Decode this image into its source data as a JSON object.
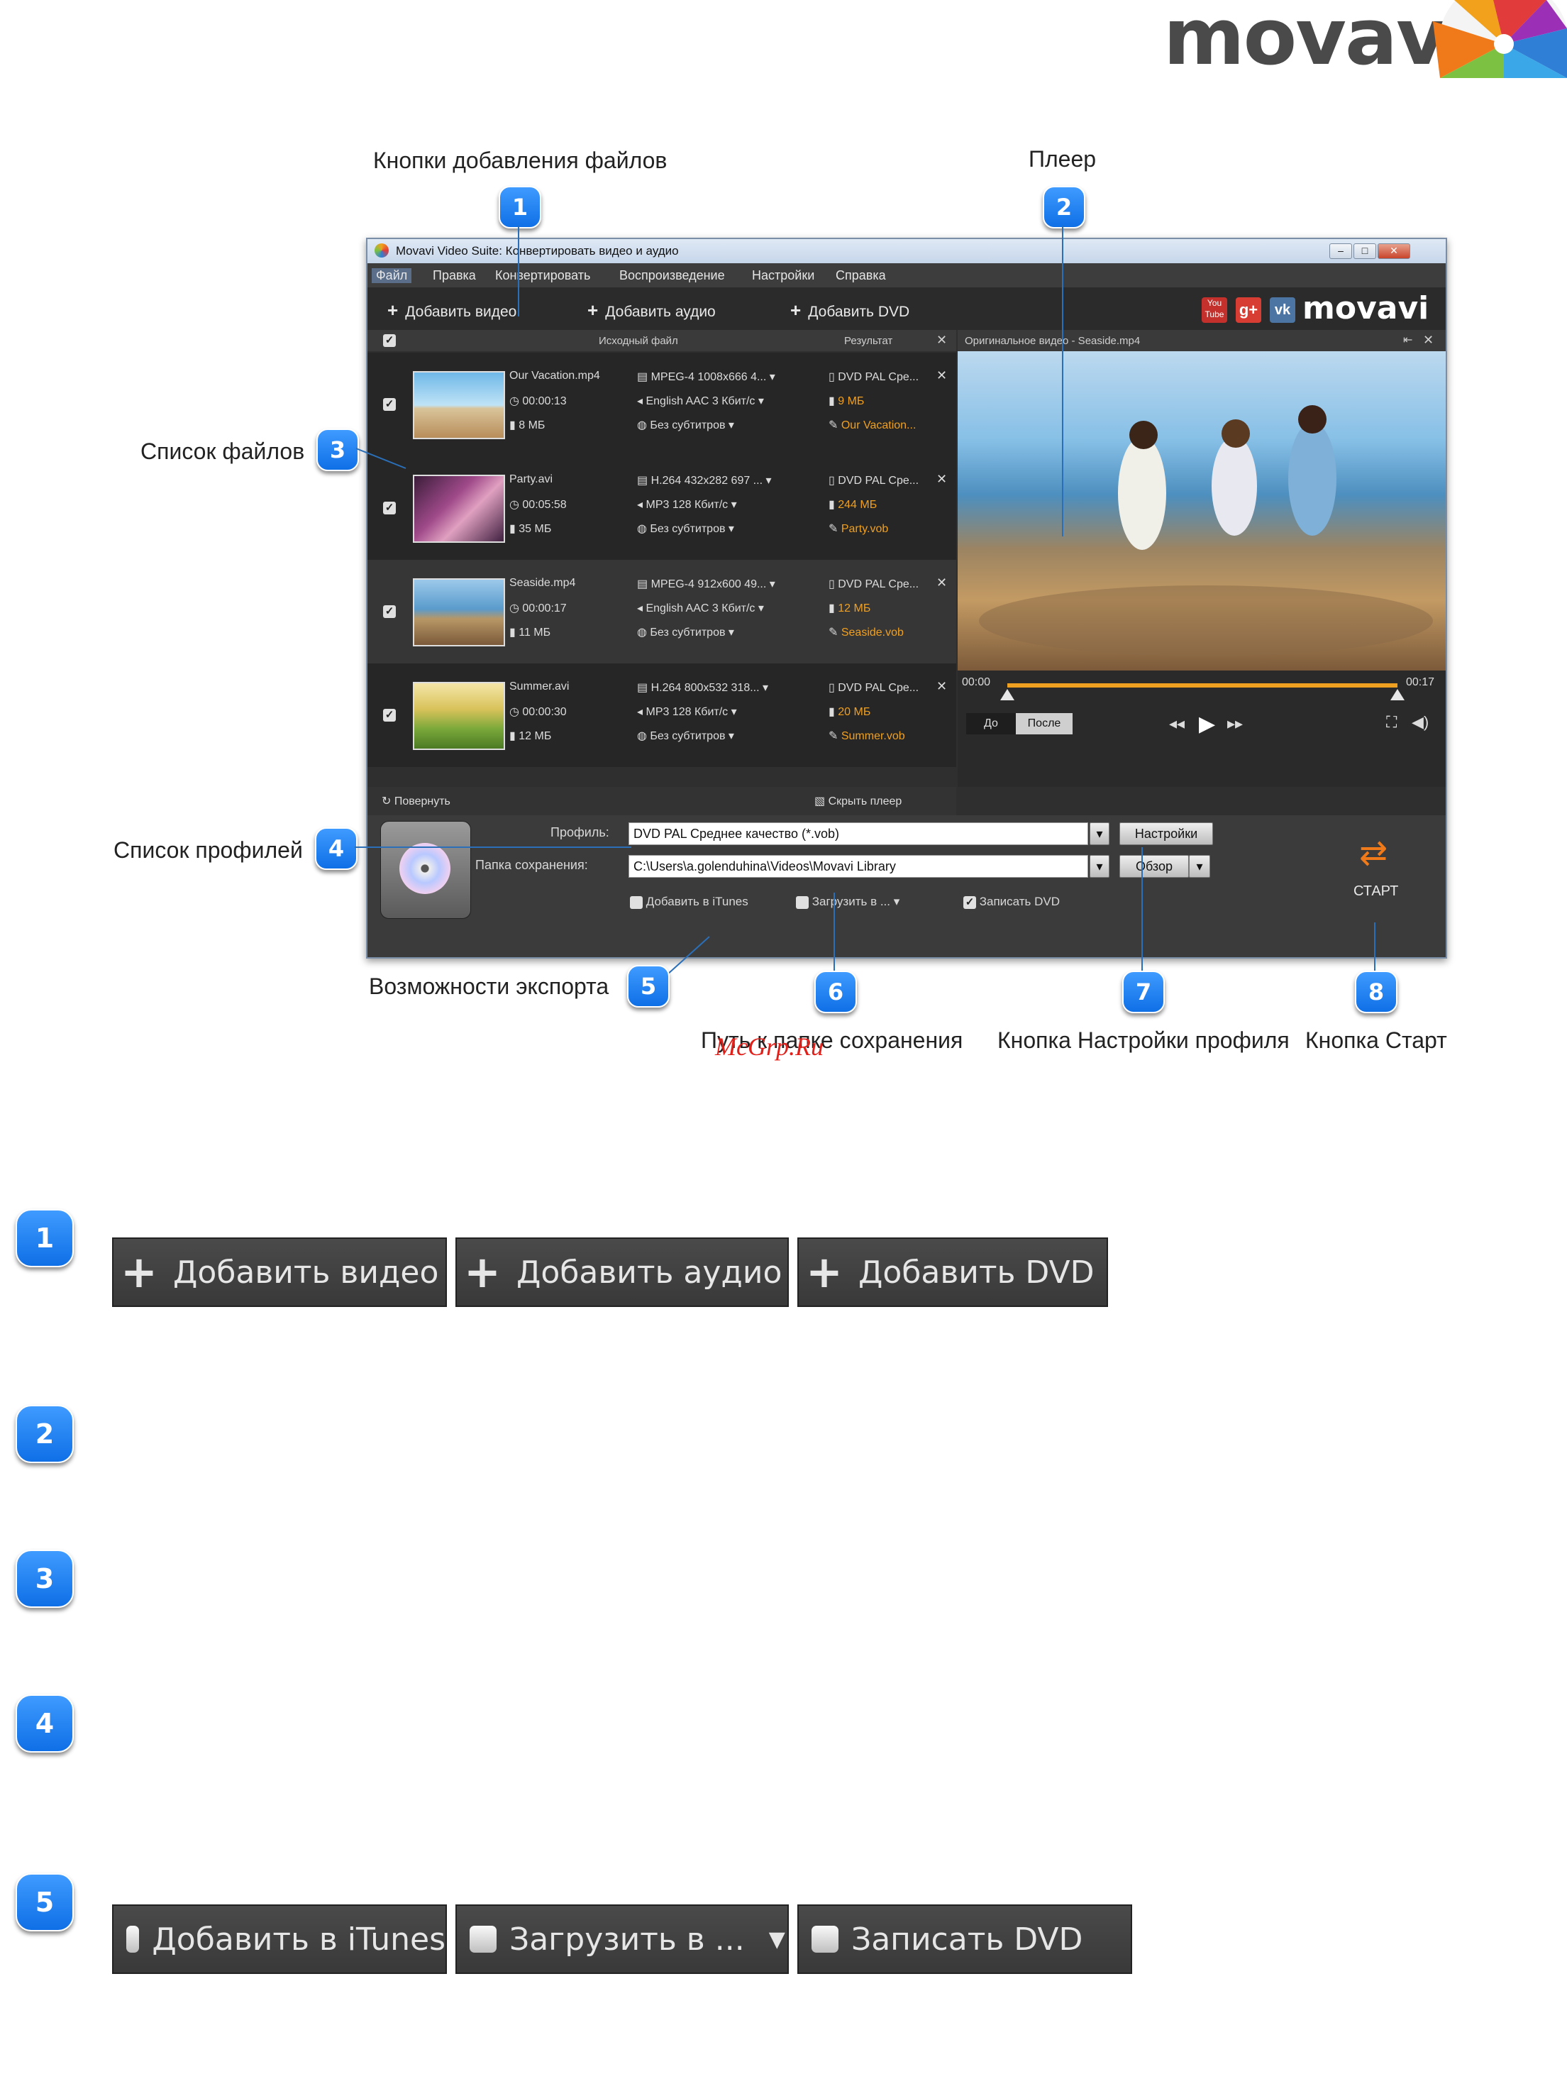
{
  "logo": {
    "text": "movavi"
  },
  "callouts": {
    "add_buttons": "Кнопки добавления файлов",
    "player": "Плеер",
    "file_list": "Список файлов",
    "profile_list": "Список профилей",
    "export_options": "Возможности экспорта",
    "save_path": "Путь к папке сохранения",
    "profile_settings": "Кнопка Настройки профиля",
    "start_button": "Кнопка Старт",
    "watermark": "McGrp.Ru"
  },
  "markers": [
    "1",
    "2",
    "3",
    "4",
    "5",
    "6",
    "7",
    "8"
  ],
  "app": {
    "title": "Movavi Video Suite: Конвертировать видео и аудио",
    "menu": [
      "Файл",
      "Правка",
      "Конвертировать",
      "Воспроизведение",
      "Настройки",
      "Справка"
    ],
    "toolbar": {
      "add_video": "Добавить видео",
      "add_audio": "Добавить аудио",
      "add_dvd": "Добавить DVD"
    },
    "social": {
      "youtube": "You Tube",
      "gplus": "g+",
      "vk": "vk",
      "brand": "movavi"
    },
    "list_header": {
      "source": "Исходный файл",
      "result": "Результат"
    },
    "player_header": "Оригинальное видео - Seaside.mp4",
    "files": [
      {
        "name": "Our Vacation.mp4",
        "duration": "00:00:13",
        "size": "8 МБ",
        "video": "MPEG-4 1008x666 4...",
        "audio": "English AAC 3 Кбит/с",
        "subs": "Без субтитров",
        "profile": "DVD PAL Сре...",
        "out_size": "9 МБ",
        "out_name": "Our Vacation..."
      },
      {
        "name": "Party.avi",
        "duration": "00:05:58",
        "size": "35 МБ",
        "video": "H.264 432x282 697 ...",
        "audio": "MP3 128 Кбит/с",
        "subs": "Без субтитров",
        "profile": "DVD PAL Сре...",
        "out_size": "244 МБ",
        "out_name": "Party.vob"
      },
      {
        "name": "Seaside.mp4",
        "duration": "00:00:17",
        "size": "11 МБ",
        "video": "MPEG-4 912x600 49...",
        "audio": "English AAC 3 Кбит/с",
        "subs": "Без субтитров",
        "profile": "DVD PAL Сре...",
        "out_size": "12 МБ",
        "out_name": "Seaside.vob"
      },
      {
        "name": "Summer.avi",
        "duration": "00:00:30",
        "size": "12 МБ",
        "video": "H.264 800x532 318...",
        "audio": "MP3 128 Кбит/с",
        "subs": "Без субтитров",
        "profile": "DVD PAL Сре...",
        "out_size": "20 МБ",
        "out_name": "Summer.vob"
      }
    ],
    "timeline": {
      "start": "00:00",
      "end": "00:17"
    },
    "before": "До",
    "after": "После",
    "rotate": "Повернуть",
    "hide_player": "Скрыть плеер",
    "profile_label": "Профиль:",
    "profile_value": "DVD PAL Среднее качество (*.vob)",
    "settings_btn": "Настройки",
    "folder_label": "Папка сохранения:",
    "folder_value": "C:\\Users\\a.golenduhina\\Videos\\Movavi Library",
    "browse_btn": "Обзор",
    "export": {
      "itunes": "Добавить в iTunes",
      "upload": "Загрузить в ...",
      "dvd": "Записать DVD"
    },
    "start": "СТАРТ"
  },
  "section1": {
    "add_video": "Добавить видео",
    "add_audio": "Добавить аудио",
    "add_dvd": "Добавить DVD"
  },
  "section5": {
    "itunes": "Добавить в iTunes",
    "upload": "Загрузить в ...",
    "dvd": "Записать DVD"
  },
  "colors": {
    "accent": "#1e7bef",
    "window_bg": "#2f2f2f",
    "timeline": "#f0a020",
    "output_text": "#f0a020"
  }
}
